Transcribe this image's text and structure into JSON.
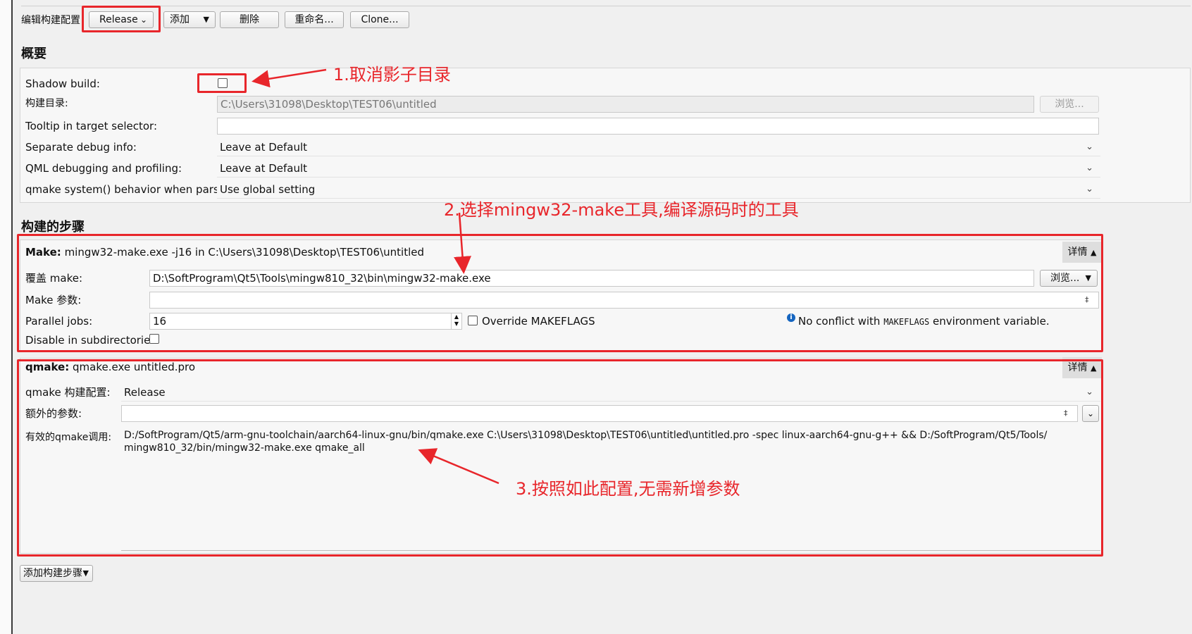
{
  "toolbar": {
    "edit_config_label": "编辑构建配置",
    "config_value": "Release",
    "add_label": "添加",
    "delete_label": "删除",
    "rename_label": "重命名...",
    "clone_label": "Clone..."
  },
  "general": {
    "heading": "概要",
    "shadow_build_label": "Shadow build:",
    "build_dir_label": "构建目录:",
    "build_dir_value": "C:\\Users\\31098\\Desktop\\TEST06\\untitled",
    "browse_label": "浏览...",
    "tooltip_label": "Tooltip in target selector:",
    "tooltip_value": "",
    "sep_debug_label": "Separate debug info:",
    "sep_debug_value": "Leave at Default",
    "qml_debug_label": "QML debugging and profiling:",
    "qml_debug_value": "Leave at Default",
    "qmake_behavior_label": "qmake system() behavior when parsing:",
    "qmake_behavior_value": "Use global setting"
  },
  "build_steps": {
    "heading": "构建的步骤",
    "make": {
      "title_bold": "Make:",
      "title_rest": " mingw32-make.exe -j16 in C:\\Users\\31098\\Desktop\\TEST06\\untitled",
      "details_label": "详情",
      "override_label": "覆盖 make:",
      "override_value": "D:\\SoftProgram\\Qt5\\Tools\\mingw810_32\\bin\\mingw32-make.exe",
      "browse_label": "浏览...",
      "args_label": "Make 参数:",
      "args_value": "",
      "jobs_label": "Parallel jobs:",
      "jobs_value": "16",
      "override_flags_label": "Override MAKEFLAGS",
      "info_prefix": "No conflict with ",
      "info_mono": "MAKEFLAGS",
      "info_suffix": " environment variable.",
      "disable_subdirs_label": "Disable in subdirectories:"
    },
    "qmake": {
      "title_bold": "qmake:",
      "title_rest": " qmake.exe untitled.pro",
      "details_label": "详情",
      "config_label": "qmake 构建配置:",
      "config_value": "Release",
      "extra_args_label": "额外的参数:",
      "extra_args_value": "",
      "effective_label": "有效的qmake调用:",
      "effective_line1": "D:/SoftProgram/Qt5/arm-gnu-toolchain/aarch64-linux-gnu/bin/qmake.exe C:\\Users\\31098\\Desktop\\TEST06\\untitled\\untitled.pro -spec linux-aarch64-gnu-g++ && D:/SoftProgram/Qt5/Tools/",
      "effective_line2": "mingw810_32/bin/mingw32-make.exe qmake_all"
    },
    "add_step_label": "添加构建步骤"
  },
  "annotations": {
    "a1": "1.取消影子目录",
    "a2": "2.选择mingw32-make工具,编译源码时的工具",
    "a3": "3.按照如此配置,无需新增参数"
  },
  "colors": {
    "annotation": "#e8262b",
    "info_icon": "#1565c0"
  }
}
